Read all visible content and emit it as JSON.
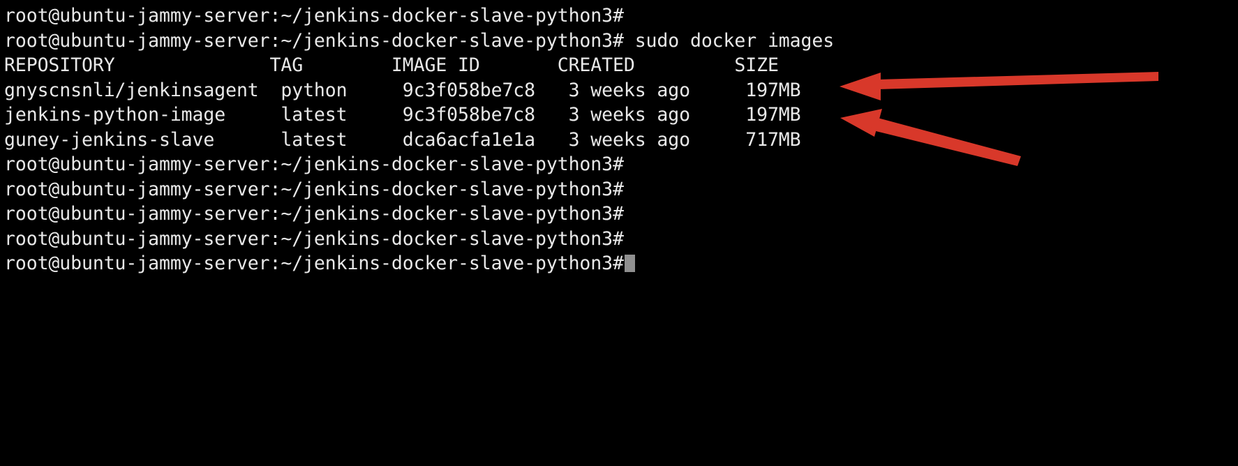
{
  "terminal": {
    "prompt": "root@ubuntu-jammy-server:~/jenkins-docker-slave-python3#",
    "command": "sudo docker images",
    "lines": [
      {
        "type": "prompt",
        "text": "root@ubuntu-jammy-server:~/jenkins-docker-slave-python3#"
      },
      {
        "type": "command",
        "text": "root@ubuntu-jammy-server:~/jenkins-docker-slave-python3# sudo docker images"
      },
      {
        "type": "header",
        "text": "REPOSITORY              TAG        IMAGE ID       CREATED         SIZE"
      },
      {
        "type": "row",
        "text": "gnyscnsnli/jenkinsagent  python     9c3f058be7c8   3 weeks ago     197MB"
      },
      {
        "type": "row",
        "text": "jenkins-python-image     latest     9c3f058be7c8   3 weeks ago     197MB"
      },
      {
        "type": "row",
        "text": "guney-jenkins-slave      latest     dca6acfa1e1a   3 weeks ago     717MB"
      },
      {
        "type": "prompt",
        "text": "root@ubuntu-jammy-server:~/jenkins-docker-slave-python3#"
      },
      {
        "type": "prompt",
        "text": "root@ubuntu-jammy-server:~/jenkins-docker-slave-python3#"
      },
      {
        "type": "prompt",
        "text": "root@ubuntu-jammy-server:~/jenkins-docker-slave-python3#"
      },
      {
        "type": "prompt",
        "text": "root@ubuntu-jammy-server:~/jenkins-docker-slave-python3#"
      },
      {
        "type": "prompt-cursor",
        "text": "root@ubuntu-jammy-server:~/jenkins-docker-slave-python3#"
      }
    ],
    "table": {
      "columns": [
        "REPOSITORY",
        "TAG",
        "IMAGE ID",
        "CREATED",
        "SIZE"
      ],
      "rows": [
        {
          "repository": "gnyscnsnli/jenkinsagent",
          "tag": "python",
          "image_id": "9c3f058be7c8",
          "created": "3 weeks ago",
          "size": "197MB"
        },
        {
          "repository": "jenkins-python-image",
          "tag": "latest",
          "image_id": "9c3f058be7c8",
          "created": "3 weeks ago",
          "size": "197MB"
        },
        {
          "repository": "guney-jenkins-slave",
          "tag": "latest",
          "image_id": "dca6acfa1e1a",
          "created": "3 weeks ago",
          "size": "717MB"
        }
      ]
    },
    "colors": {
      "background": "#000000",
      "foreground": "#e8e8e8",
      "cursor": "#8f8f8f",
      "annotation": "#d8382a"
    }
  },
  "annotations": {
    "arrows": [
      {
        "name": "arrow-row-1",
        "target": "197MB (gnyscnsnli/jenkinsagent)"
      },
      {
        "name": "arrow-row-2",
        "target": "197MB (jenkins-python-image)"
      }
    ]
  }
}
